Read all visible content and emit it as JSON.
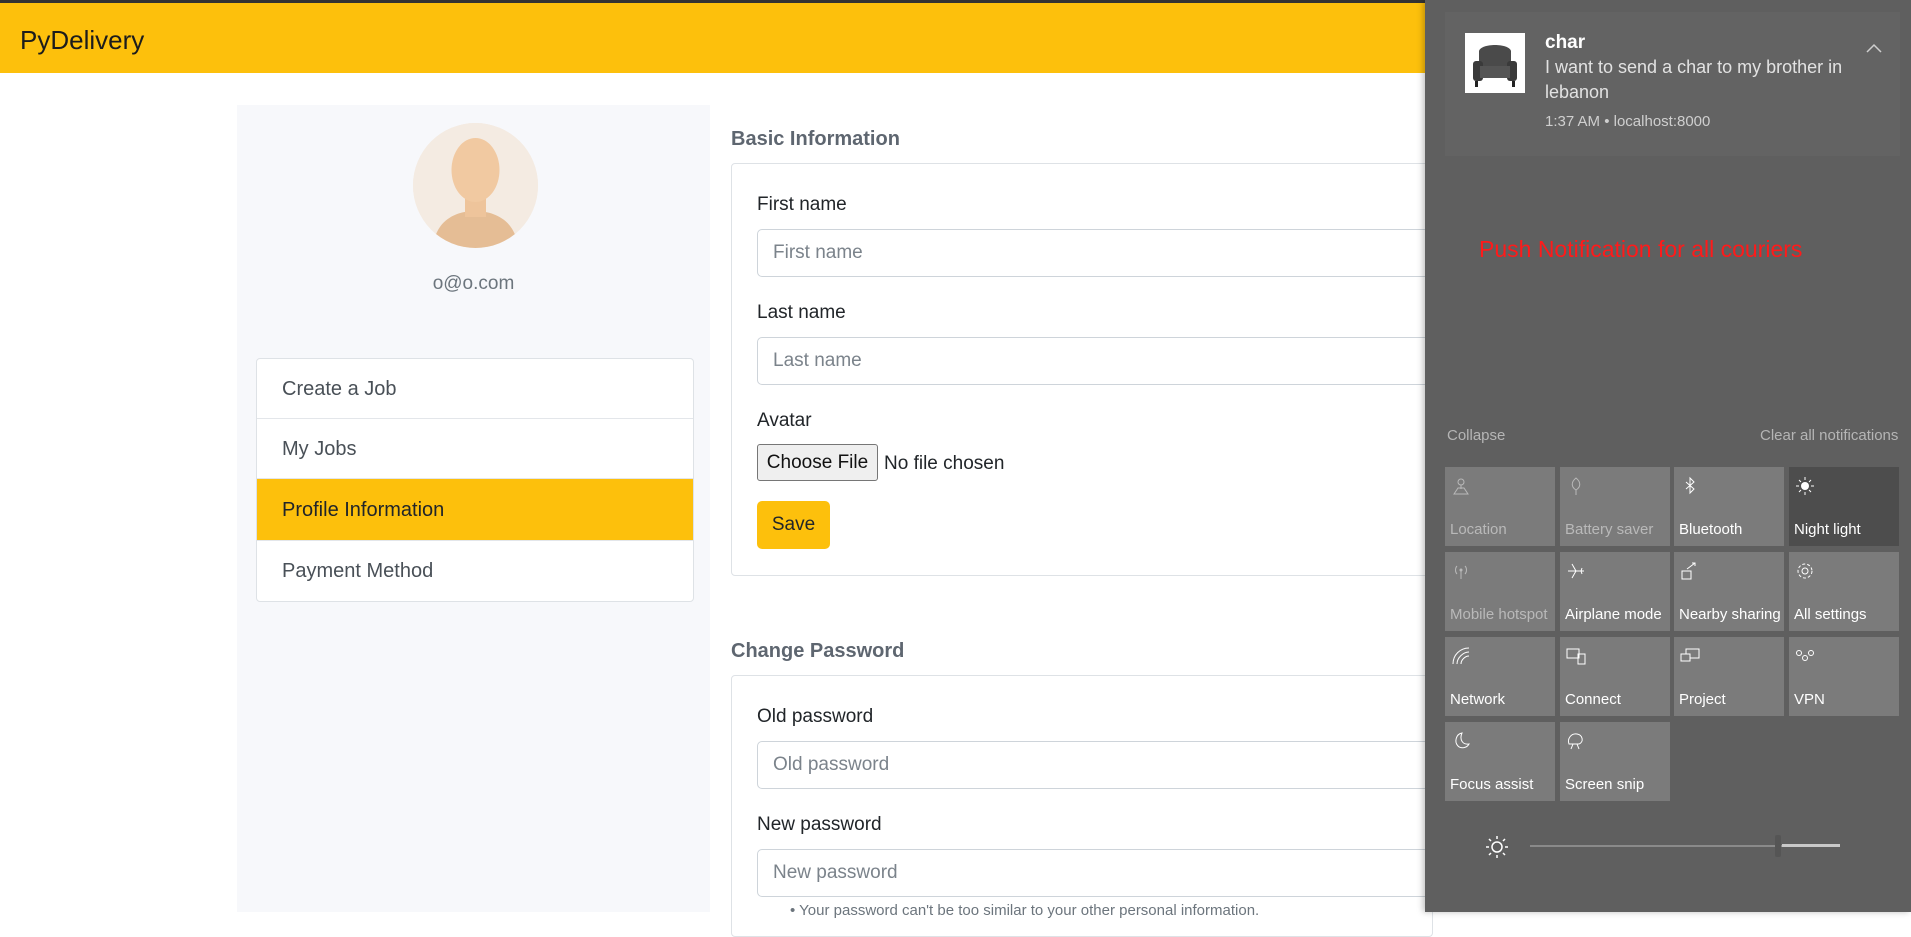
{
  "app": {
    "brand": "PyDelivery"
  },
  "profile": {
    "email": "o@o.com"
  },
  "sidebar": {
    "items": [
      {
        "label": "Create a Job",
        "active": false
      },
      {
        "label": "My Jobs",
        "active": false
      },
      {
        "label": "Profile Information",
        "active": true
      },
      {
        "label": "Payment Method",
        "active": false
      }
    ]
  },
  "basic_info": {
    "title": "Basic Information",
    "first_name_label": "First name",
    "first_name_placeholder": "First name",
    "last_name_label": "Last name",
    "last_name_placeholder": "Last name",
    "avatar_label": "Avatar",
    "choose_file": "Choose File",
    "no_file": "No file chosen",
    "save": "Save"
  },
  "change_password": {
    "title": "Change Password",
    "old_label": "Old password",
    "old_placeholder": "Old password",
    "new_label": "New password",
    "new_placeholder": "New password",
    "help": "Your password can't be too similar to your other personal information."
  },
  "action_center": {
    "notification": {
      "title": "char",
      "body": "I want to send a char to my brother in lebanon",
      "meta": "1:37 AM • localhost:8000"
    },
    "annotation": "Push Notification for all couriers",
    "collapse": "Collapse",
    "clear_all": "Clear all notifications",
    "tiles": [
      {
        "label": "Location",
        "icon": "location-icon",
        "state": "disabled"
      },
      {
        "label": "Battery saver",
        "icon": "battery-saver-icon",
        "state": "disabled"
      },
      {
        "label": "Bluetooth",
        "icon": "bluetooth-icon",
        "state": "off"
      },
      {
        "label": "Night light",
        "icon": "night-light-icon",
        "state": "on"
      },
      {
        "label": "Mobile hotspot",
        "icon": "mobile-hotspot-icon",
        "state": "disabled"
      },
      {
        "label": "Airplane mode",
        "icon": "airplane-icon",
        "state": "off"
      },
      {
        "label": "Nearby sharing",
        "icon": "nearby-sharing-icon",
        "state": "off"
      },
      {
        "label": "All settings",
        "icon": "settings-icon",
        "state": "off"
      },
      {
        "label": "Network",
        "icon": "network-icon",
        "state": "off"
      },
      {
        "label": "Connect",
        "icon": "connect-icon",
        "state": "off"
      },
      {
        "label": "Project",
        "icon": "project-icon",
        "state": "off"
      },
      {
        "label": "VPN",
        "icon": "vpn-icon",
        "state": "off"
      },
      {
        "label": "Focus assist",
        "icon": "focus-assist-icon",
        "state": "off"
      },
      {
        "label": "Screen snip",
        "icon": "screen-snip-icon",
        "state": "off"
      }
    ],
    "brightness": 0.8
  }
}
